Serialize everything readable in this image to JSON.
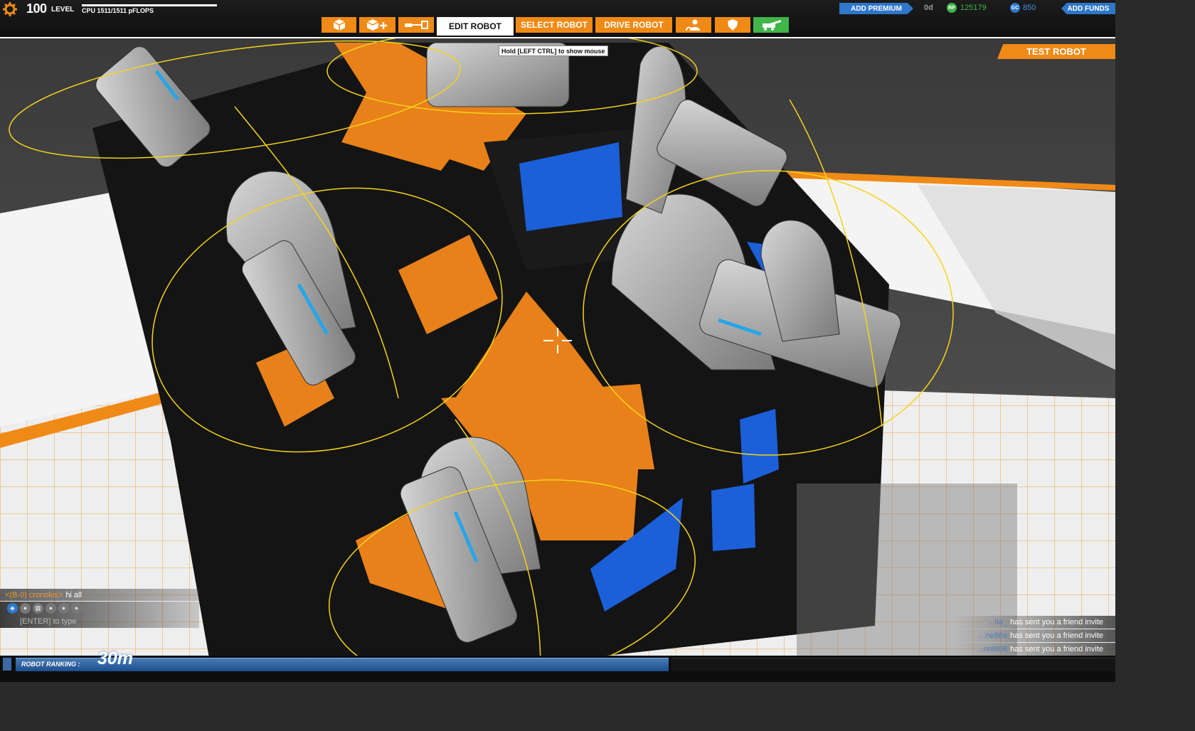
{
  "header": {
    "level_number": "100",
    "level_label": "LEVEL",
    "cpu_text": "CPU 1511/1511 pFLOPS",
    "tabs": [
      {
        "label": "",
        "icon": "cube-icon"
      },
      {
        "label": "",
        "icon": "cube-plus-icon"
      },
      {
        "label": "",
        "icon": "connector-icon"
      },
      {
        "label": "EDIT ROBOT"
      },
      {
        "label": "SELECT ROBOT"
      },
      {
        "label": "DRIVE ROBOT"
      },
      {
        "label": "",
        "icon": "players-icon"
      },
      {
        "label": "",
        "icon": "shield-icon"
      },
      {
        "label": "",
        "icon": "garage-icon"
      }
    ],
    "add_premium": "ADD PREMIUM",
    "premium_timer": "0d",
    "rp_icon_text": "RP",
    "rp_value": "125179",
    "gc_icon_text": "GC",
    "gc_value": "850",
    "add_funds": "ADD FUNDS"
  },
  "tooltip": "Hold [LEFT CTRL] to show mouse",
  "test_robot": "TEST ROBOT",
  "chat": {
    "user": "<(B-0) cronokis>",
    "message": "hi all",
    "channels": [
      "globe-icon",
      "clan-icon",
      "party-icon",
      "friend-icon",
      "friend-icon",
      "friend-icon"
    ],
    "input_placeholder": "[ENTER] to type"
  },
  "notifications": [
    {
      "user": "...ita_",
      "message": "has sent you a friend invite"
    },
    {
      "user": "...ne86a",
      "message": "has sent you a friend invite"
    },
    {
      "user": "...not808",
      "message": "has sent you a friend invite"
    }
  ],
  "ranking": {
    "label": "ROBOT RANKING :",
    "value": "30m"
  },
  "colors": {
    "orange": "#f08a16",
    "blue": "#2e77c9",
    "green": "#3fb54a",
    "scene_orange": "#e8811a"
  }
}
